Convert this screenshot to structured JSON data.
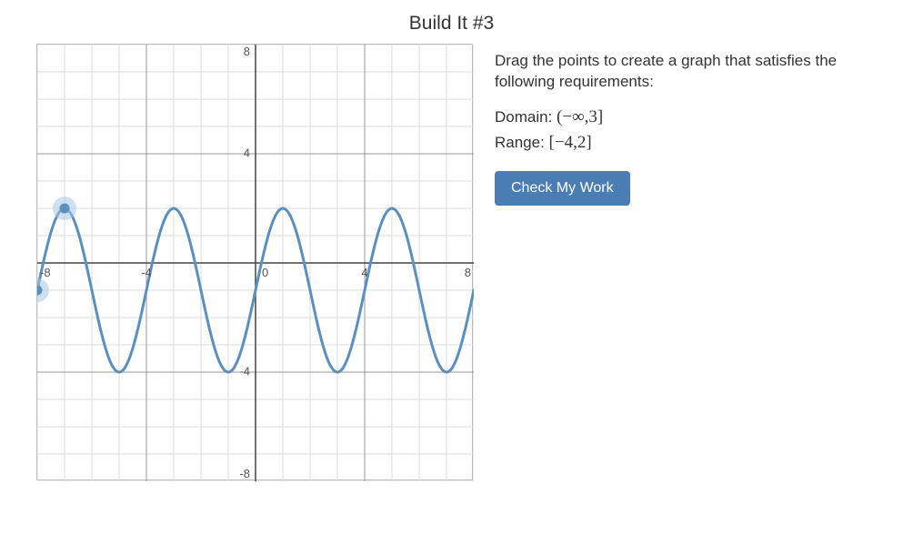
{
  "title": "Build It #3",
  "instructions": "Drag the points to create a graph that satisfies the following requirements:",
  "domain_label": "Domain: ",
  "domain_value": "(−∞,3]",
  "range_label": "Range: ",
  "range_value": "[−4,2]",
  "check_button": "Check My Work",
  "chart_data": {
    "type": "line",
    "title": "",
    "xlabel": "",
    "ylabel": "",
    "xlim": [
      -8,
      8
    ],
    "ylim": [
      -8,
      8
    ],
    "x_ticks": [
      -8,
      -4,
      0,
      4,
      8
    ],
    "y_ticks": [
      -8,
      -4,
      4,
      8
    ],
    "grid_step": 1,
    "curve": {
      "description": "sinusoidal",
      "amplitude": 3,
      "midline": -1,
      "period": 4,
      "phase_peak_at_x": -7,
      "x_start": -8,
      "x_end": 8
    },
    "drag_points": [
      {
        "x": -8,
        "y": -1
      },
      {
        "x": -7,
        "y": 2
      }
    ]
  }
}
